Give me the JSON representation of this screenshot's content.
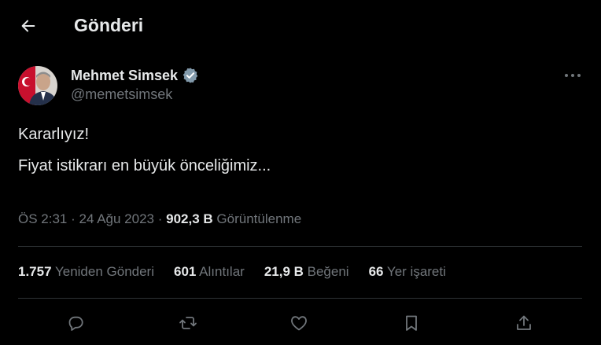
{
  "header": {
    "title": "Gönderi"
  },
  "author": {
    "name": "Mehmet Simsek",
    "handle": "@memetsimsek"
  },
  "tweet": {
    "line1": "Kararlıyız!",
    "line2": "Fiyat istikrarı en büyük önceliğimiz..."
  },
  "meta": {
    "time": "ÖS 2:31",
    "separator": "·",
    "date": "24 Ağu 2023",
    "views_num": "902,3 B",
    "views_label": "Görüntülenme"
  },
  "stats": {
    "reposts_num": "1.757",
    "reposts_label": "Yeniden Gönderi",
    "quotes_num": "601",
    "quotes_label": "Alıntılar",
    "likes_num": "21,9 B",
    "likes_label": "Beğeni",
    "bookmarks_num": "66",
    "bookmarks_label": "Yer işareti"
  },
  "icons": {
    "back": "back-arrow-icon",
    "verified": "verified-badge-icon",
    "more": "more-icon",
    "reply": "reply-icon",
    "repost": "repost-icon",
    "like": "heart-icon",
    "bookmark": "bookmark-icon",
    "share": "share-icon"
  },
  "colors": {
    "background": "#000000",
    "text_primary": "#e7e9ea",
    "text_secondary": "#71767b",
    "verified": "#829aab",
    "divider": "#2f3336"
  }
}
